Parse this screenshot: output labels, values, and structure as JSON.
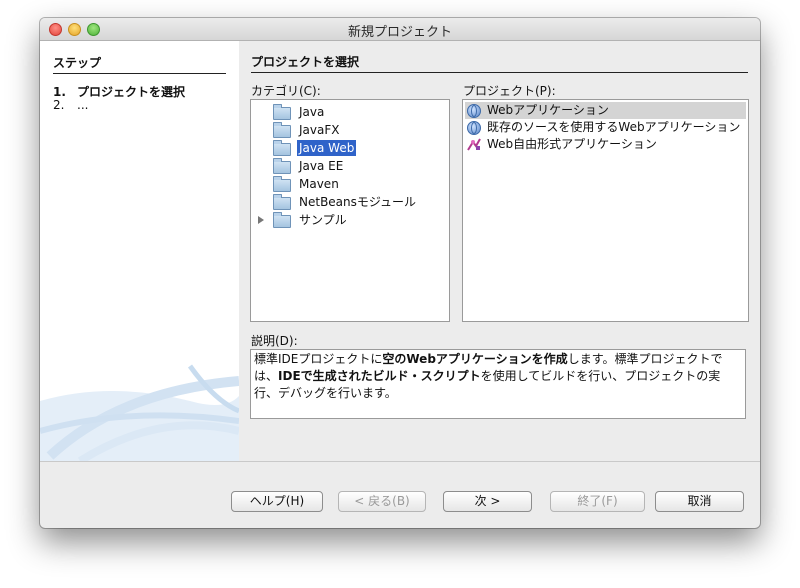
{
  "window": {
    "title": "新規プロジェクト"
  },
  "steps": {
    "header": "ステップ",
    "items": [
      {
        "num": "1.",
        "label": "プロジェクトを選択"
      },
      {
        "num": "2.",
        "label": "..."
      }
    ]
  },
  "page_title": "プロジェクトを選択",
  "categories": {
    "label": "カテゴリ(C):",
    "items": [
      {
        "label": "Java"
      },
      {
        "label": "JavaFX"
      },
      {
        "label": "Java Web",
        "selected": true
      },
      {
        "label": "Java EE"
      },
      {
        "label": "Maven"
      },
      {
        "label": "NetBeansモジュール"
      },
      {
        "label": "サンプル",
        "expandable": true
      }
    ]
  },
  "projects": {
    "label": "プロジェクト(P):",
    "items": [
      {
        "label": "Webアプリケーション",
        "icon": "globe-icon",
        "selected": true
      },
      {
        "label": "既存のソースを使用するWebアプリケーション",
        "icon": "globe-icon"
      },
      {
        "label": "Web自由形式アプリケーション",
        "icon": "freeform-icon"
      }
    ]
  },
  "description": {
    "label": "説明(D):",
    "parts": [
      {
        "text": "標準IDEプロジェクトに",
        "bold": false
      },
      {
        "text": "空のWebアプリケーションを作成",
        "bold": true
      },
      {
        "text": "します。標準プロジェクトでは、",
        "bold": false
      },
      {
        "text": "IDEで生成されたビルド・スクリプト",
        "bold": true
      },
      {
        "text": "を使用してビルドを行い、プロジェクトの実行、デバッグを行います。",
        "bold": false
      }
    ]
  },
  "buttons": {
    "help": "ヘルプ(H)",
    "back": "< 戻る(B)",
    "next": "次 >",
    "finish": "終了(F)",
    "cancel": "取消"
  }
}
